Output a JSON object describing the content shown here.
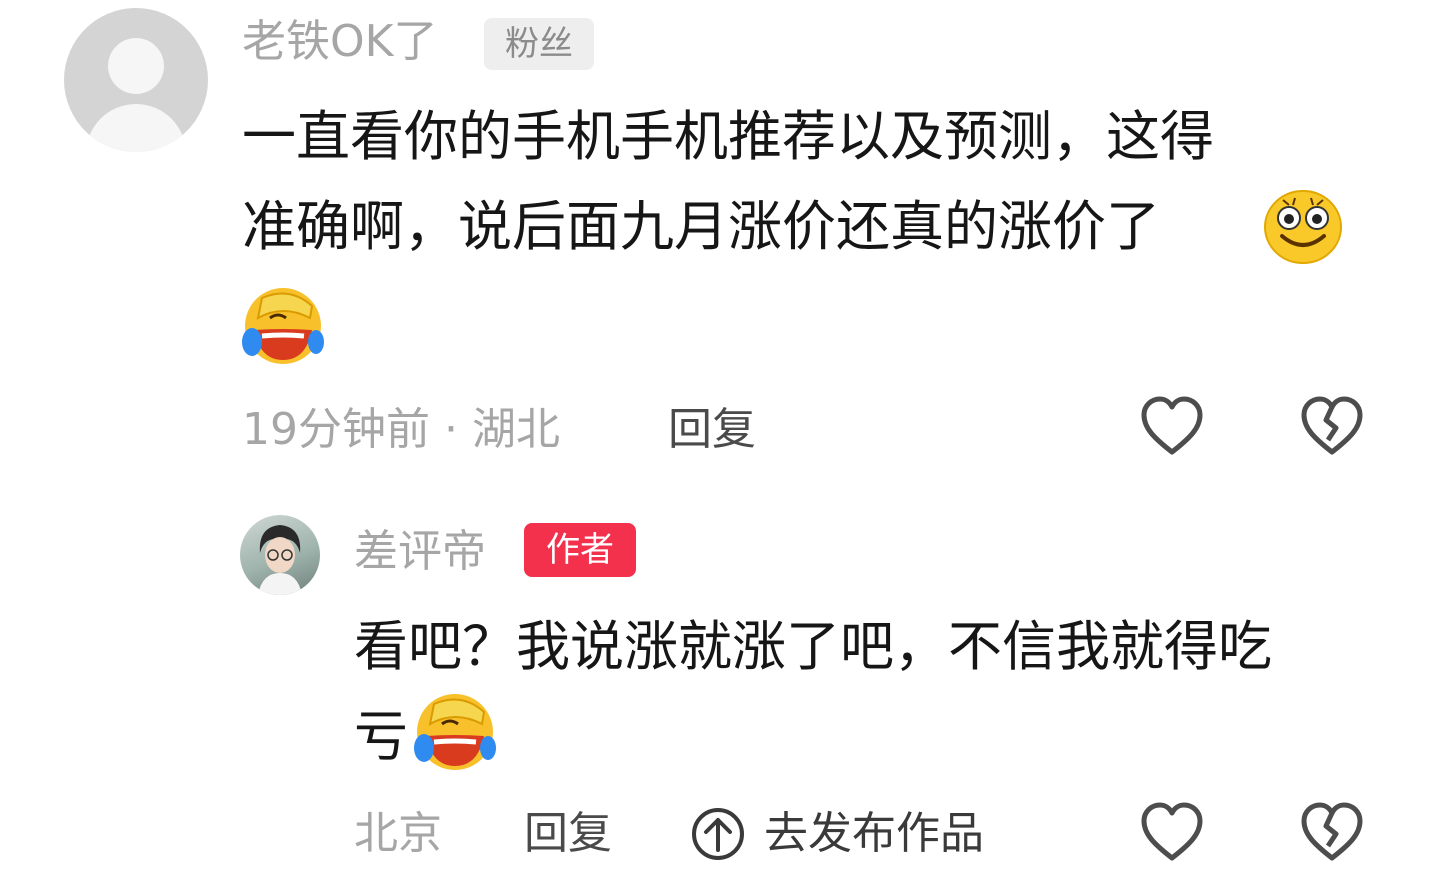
{
  "comment": {
    "username": "老铁OK了",
    "badge": "粉丝",
    "text_lines": [
      "一直看你的手机手机推荐以及预测，这得",
      "准确啊，说后面九月涨价还真的涨价了"
    ],
    "emojis": [
      "smile-emoji-icon",
      "facepalm-laugh-emoji-icon"
    ],
    "meta": "19分钟前 · 湖北",
    "reply_label": "回复"
  },
  "reply": {
    "username": "差评帝",
    "badge": "作者",
    "text_lines": [
      "看吧？我说涨就涨了吧，不信我就得吃",
      "亏"
    ],
    "emojis": [
      "facepalm-laugh-emoji-icon"
    ],
    "location": "北京",
    "reply_label": "回复"
  },
  "overlay": {
    "label": "去发布作品"
  },
  "colors": {
    "muted_text": "#a6a6a6",
    "body_text": "#161616",
    "author_badge": "#f3314d",
    "icon_stroke": "#4d4d4d"
  }
}
